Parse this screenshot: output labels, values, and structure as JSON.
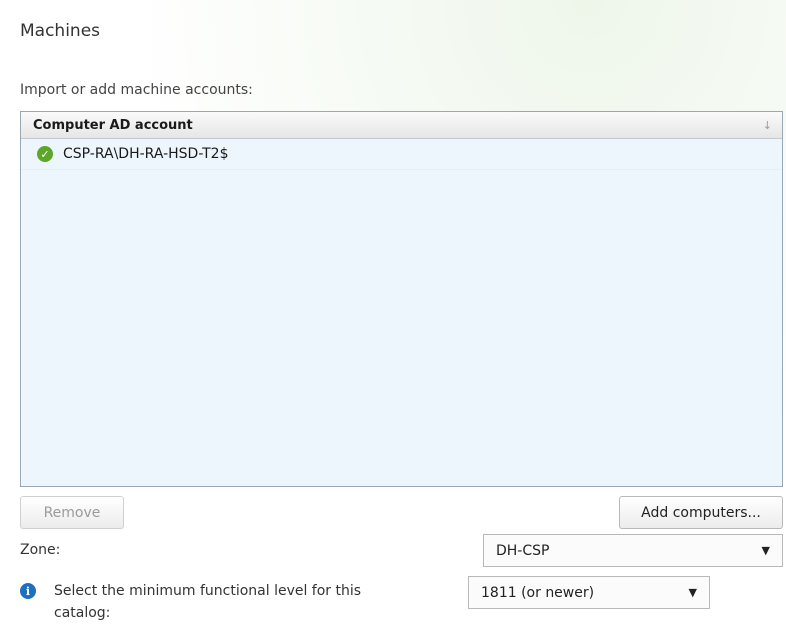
{
  "section": {
    "title": "Machines"
  },
  "import": {
    "label": "Import or add machine accounts:"
  },
  "list": {
    "column_header": "Computer AD account",
    "sort_icon": "sort-arrow-down-icon",
    "rows": [
      {
        "status_icon": "check-circle-icon",
        "account": "CSP-RA\\DH-RA-HSD-T2$"
      }
    ]
  },
  "buttons": {
    "remove_label": "Remove",
    "add_computers_label": "Add computers..."
  },
  "zone": {
    "label": "Zone:",
    "selected": "DH-CSP"
  },
  "functional_level": {
    "text": "Select the minimum functional level for this catalog:",
    "selected": "1811 (or newer)"
  },
  "colors": {
    "list_background": "#eef6fd",
    "status_ok": "#5ea629",
    "info_blue": "#1f6fbf"
  }
}
